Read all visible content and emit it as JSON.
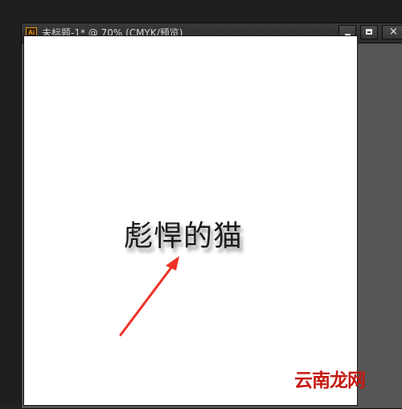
{
  "window": {
    "app_icon": "illustrator-ai-icon",
    "app_icon_text": "Ai",
    "title": "未标题-1* @ 70% (CMYK/预览)",
    "controls": {
      "minimize": "minimize-icon",
      "maximize": "maximize-icon",
      "close": "close-icon",
      "close_glyph": "×"
    }
  },
  "artboard": {
    "text": "彪悍的猫"
  },
  "annotation": {
    "arrow_color": "#ee3124"
  },
  "watermark": {
    "text": "云南龙网"
  }
}
